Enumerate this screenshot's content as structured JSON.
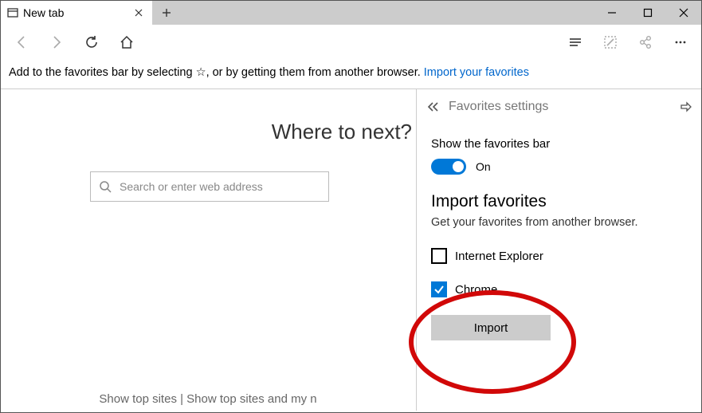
{
  "titlebar": {
    "tab_title": "New tab"
  },
  "favbar_message": {
    "prefix": "Add to the favorites bar by selecting ",
    "star": "☆",
    "middle": ", or by getting them from another browser. ",
    "link": "Import your favorites"
  },
  "content": {
    "headline": "Where to next?",
    "search_placeholder": "Search or enter web address",
    "bottom_links": "Show top sites  |  Show top sites and my n"
  },
  "flyout": {
    "title": "Favorites settings",
    "show_bar_label": "Show the favorites bar",
    "toggle_value": "On",
    "import_heading": "Import favorites",
    "import_sub": "Get your favorites from another browser.",
    "options": [
      {
        "label": "Internet Explorer",
        "checked": false
      },
      {
        "label": "Chrome",
        "checked": true
      }
    ],
    "import_button": "Import"
  }
}
